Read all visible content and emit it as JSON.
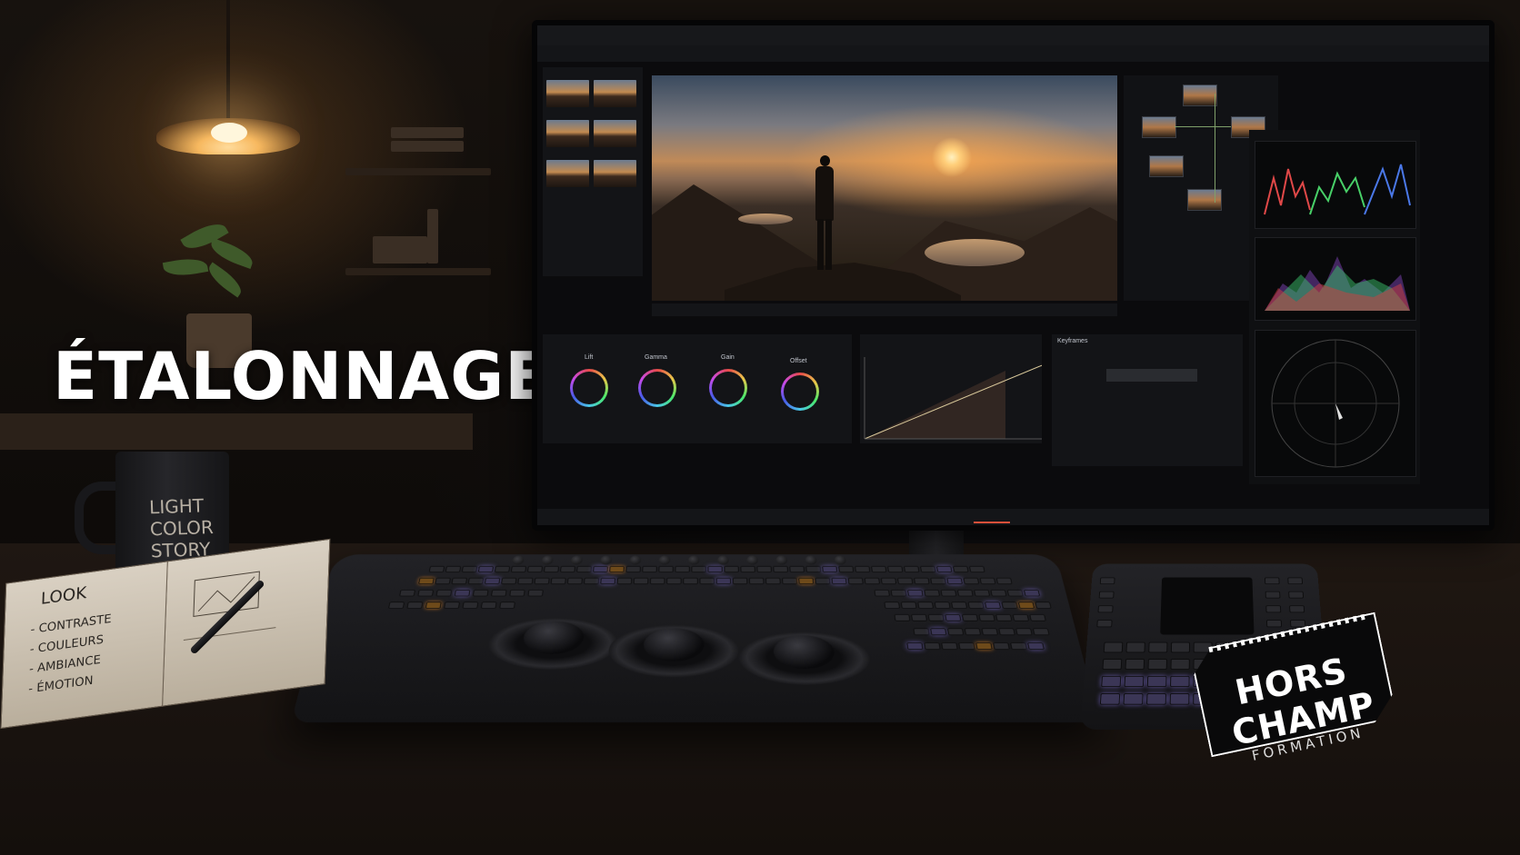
{
  "headline": "ÉTALONNAGE",
  "mug": {
    "lines": [
      "LIGHT",
      "COLOR",
      "STORY"
    ]
  },
  "notebook": {
    "heading": "LOOK",
    "items": [
      "- CONTRASTE",
      "- COULEURS",
      "- AMBIANCE",
      "- ÉMOTION"
    ]
  },
  "logo": {
    "line1": "HORS",
    "line2": "CHAMP",
    "line3": "FORMATION"
  },
  "app": {
    "primaries": {
      "wheels": [
        {
          "label": "Lift"
        },
        {
          "label": "Gamma"
        },
        {
          "label": "Gain"
        },
        {
          "label": "Offset"
        }
      ]
    },
    "keyframes_title": "Keyframes"
  },
  "colors": {
    "accent": "#e0503a",
    "title_text": "#ffffff"
  }
}
